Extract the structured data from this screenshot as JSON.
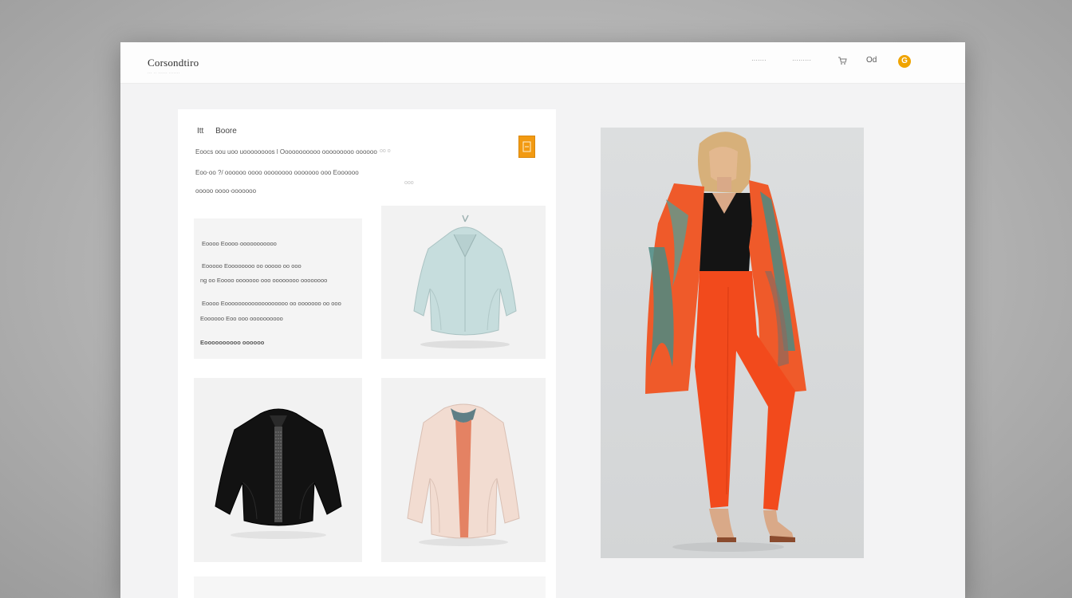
{
  "header": {
    "brand": "Corsondtiro",
    "tagline": "··· ·· ······ ·······",
    "nav": [
      "·······",
      "·········",
      "Od"
    ],
    "avatar_letter": "G"
  },
  "panel": {
    "head": [
      "Itt",
      "Boore"
    ],
    "lines": [
      "Eoocs oou uoo uoooooooos l  Ooooooooooo ooooooooo oooooo",
      "Eoo·oo ?/ oooooo oooo oooooooo ooooooo ooo Eoooooo",
      "ooooo oooo·ooooooo"
    ],
    "faint": [
      "oo o",
      "ooo"
    ]
  },
  "text_card": {
    "lines": [
      "Eoooo Eoooo·ooooooooooo",
      "Eooooo Eoooooooo oo ooooo oo ooo",
      "ng oo Eoooo ooooooo ooo oooooooo oooooooo",
      "Eoooo Eooooooooooooooooooo oo ooooooo oo ooo",
      "Eoooooo Eoo ooo oooooooooo",
      "Eoooooooooo oooooo"
    ]
  },
  "colors": {
    "accent": "#f29a12",
    "jacket_mint": "#c7dede",
    "jacket_black": "#111111",
    "jacket_blush": "#f3dcd2",
    "pants_red": "#f24a1c",
    "cardigan_orange": "#ef5a2a",
    "cardigan_teal": "#4b8b83"
  },
  "icons": [
    "cart-icon",
    "avatar-icon",
    "badge-icon"
  ]
}
